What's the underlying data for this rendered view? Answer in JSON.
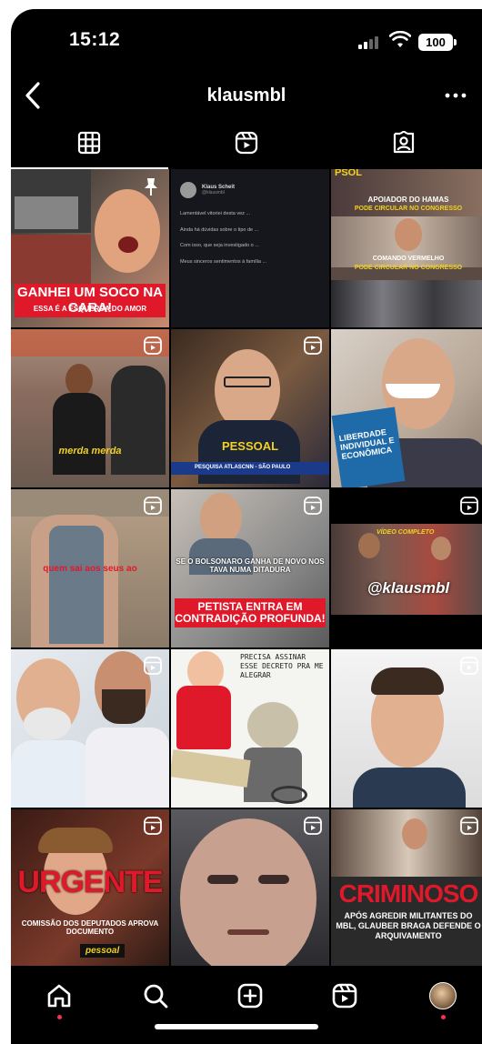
{
  "status_bar": {
    "time": "15:12",
    "battery": "100"
  },
  "header": {
    "username": "klausmbl"
  },
  "tabs": [
    {
      "name": "posts-grid",
      "icon": "grid-icon",
      "active": true
    },
    {
      "name": "reels",
      "icon": "reels-icon",
      "active": false
    },
    {
      "name": "tagged",
      "icon": "tagged-person-icon",
      "active": false
    }
  ],
  "grid": {
    "t1": {
      "caption": "GANHEI UM SOCO NA CARA!",
      "sub": "ESSA É A ESQUERDA DO AMOR"
    },
    "t2": {
      "author": "Klaus Scheit",
      "handle": "@klausmbl",
      "p1": "Lamentável vitoriei desta vez ...",
      "p2": "Ainda há dúvidas sobre o tipo de ...",
      "p3": "Com isso, que seja investigado o ...",
      "p4": "Meus sinceros sentimentos à família ..."
    },
    "t3": {
      "top": "PSOL",
      "line1": "APOIADOR DO HAMAS",
      "line1b": "PODE CIRCULAR NO CONGRESSO",
      "line2": "COMANDO VERMELHO",
      "line2b": "PODE CIRCULAR NO CONGRESSO"
    },
    "t4": {
      "caption": "merda merda"
    },
    "t5": {
      "caption": "PESSOAL",
      "ticker": "PESQUISA ATLASCNN - SÃO PAULO"
    },
    "t6": {
      "book": "LIBERDADE INDIVIDUAL E ECONÔMICA"
    },
    "t7": {
      "caption": "quem sai aos seus ao"
    },
    "t8": {
      "caption1": "SE O BOLSONARO GANHA DE NOVO NOS TAVA NUMA DITADURA",
      "caption2": "PETISTA ENTRA EM CONTRADIÇÃO PROFUNDA!"
    },
    "t9": {
      "top": "VÍDEO COMPLETO",
      "handle": "@klausmbl"
    },
    "t11": {
      "bubble": "PRECISA ASSINAR ESSE DECRETO PRA ME ALEGRAR"
    },
    "t13": {
      "big": "URGENTE",
      "sub": "COMISSÃO DOS DEPUTADOS APROVA DOCUMENTO",
      "tag": "pessoal"
    },
    "t15": {
      "big": "CRIMINOSO",
      "sub": "APÓS AGREDIR MILITANTES DO MBL, GLAUBER BRAGA DEFENDE O ARQUIVAMENTO"
    }
  },
  "nav": [
    {
      "name": "home",
      "icon": "home-icon"
    },
    {
      "name": "search",
      "icon": "search-icon"
    },
    {
      "name": "create",
      "icon": "plus-square-icon"
    },
    {
      "name": "reels",
      "icon": "reels-icon"
    },
    {
      "name": "profile",
      "icon": "avatar"
    }
  ],
  "colors": {
    "accent_red": "#e0192a",
    "caption_yellow": "#f2d21e",
    "bg": "#000000"
  }
}
